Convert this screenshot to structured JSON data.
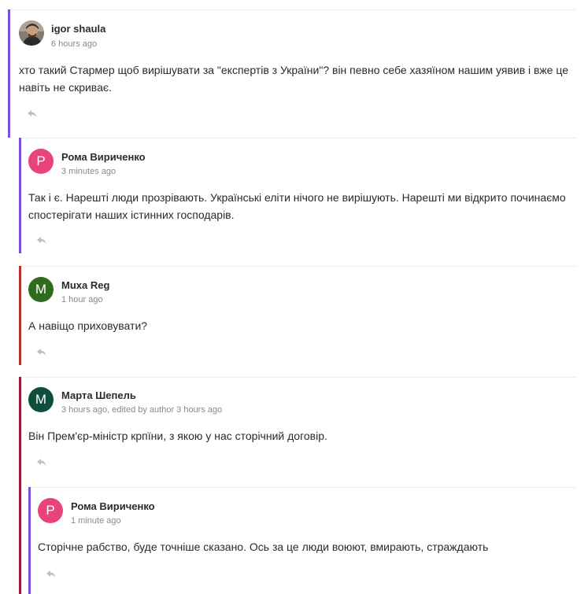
{
  "colors": {
    "accent_purple": "#7b4fd6",
    "accent_red": "#b5332a",
    "accent_crimson": "#9b1b3a",
    "avatar_pink": "#e8447a",
    "avatar_green": "#2e6b1c",
    "avatar_teal": "#0f4d3c"
  },
  "comments": [
    {
      "author": "igor shaula",
      "time": "6 hours ago",
      "text": "хто такий Стармер щоб вирішувати за \"експертів з України\"? він певно себе хазяїном нашим уявив і вже це навіть не скриває.",
      "avatar": "photo"
    },
    {
      "author": "Рома Вириченко",
      "time": "3 minutes ago",
      "text": "Так і є. Нарешті люди прозрівають. Українські еліти нічого не вирішують. Нарешті ми відкрито починаємо спостерігати наших істинних господарів.",
      "avatar": "P"
    },
    {
      "author": "Muxa Reg",
      "time": "1 hour ago",
      "text": "А навіщо приховувати?",
      "avatar": "M"
    },
    {
      "author": "Марта Шепель",
      "time": "3 hours ago, edited by author 3 hours ago",
      "text": "Він Прем'єр-міністр крпїни, з якою у нас сторічний договір.",
      "avatar": "M"
    },
    {
      "author": "Рома Вириченко",
      "time": "1 minute ago",
      "text": "Сторічне рабство, буде точніше сказано. Ось за це люди воюют, вмирають, страждають",
      "avatar": "P"
    }
  ],
  "icons": {
    "reply": "reply-icon"
  }
}
